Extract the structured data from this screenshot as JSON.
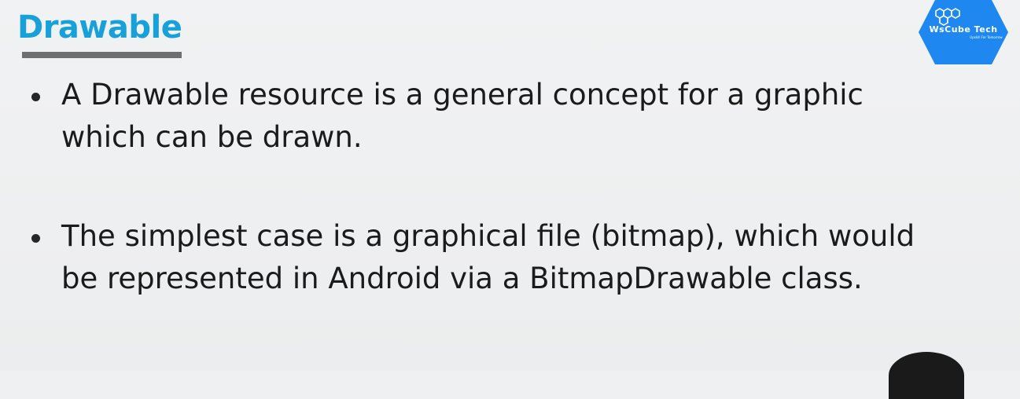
{
  "slide": {
    "title": "Drawable",
    "bullets": [
      "A Drawable resource is a general concept for a graphic which can be drawn.",
      "The simplest case is a graphical file (bitmap), which would be represented in Android via a BitmapDrawable class."
    ]
  },
  "logo": {
    "text": "WsCube Tech",
    "tagline": "Upskill For Tomorrow",
    "color": "#1e88f0"
  },
  "colors": {
    "title": "#18a0d9",
    "underline": "#6e6e6e",
    "body_text": "#1b1b1b"
  }
}
